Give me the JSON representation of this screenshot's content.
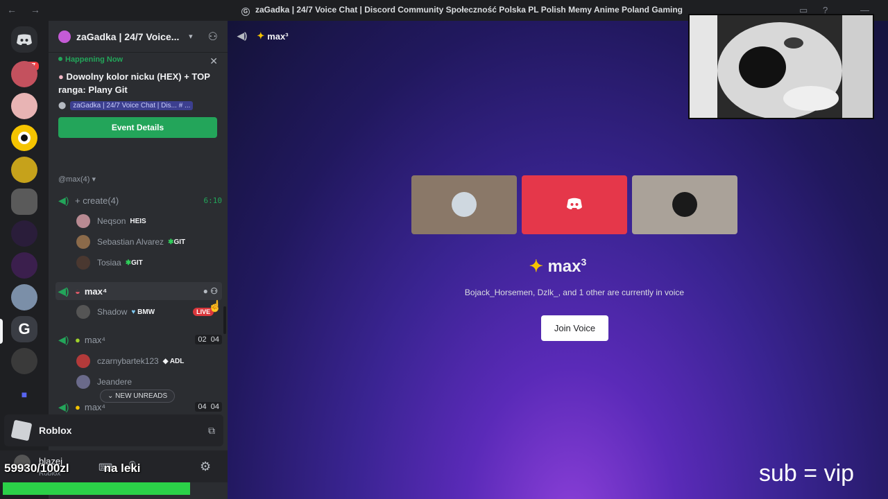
{
  "window": {
    "title": "zaGadka | 24/7 Voice Chat | Discord Community Społeczność Polska PL Polish Memy Anime Poland Gaming",
    "nav": "← →"
  },
  "rail": {
    "badge": "17"
  },
  "server": {
    "name": "zaGadka | 24/7 Voice..."
  },
  "event": {
    "status": "Happening Now",
    "title": "Dowolny kolor nicku (HEX) + TOP ranga: Plany Git",
    "location": "zaGadka | 24/7 Voice Chat | Dis...",
    "location_suffix": "# ...",
    "button": "Event Details"
  },
  "channels": {
    "category": "@max(4)",
    "items": [
      {
        "name": "+ create(4)",
        "right": "6:10"
      },
      {
        "name": "max⁴"
      },
      {
        "name": "max⁴",
        "right_a": "02",
        "right_b": "04"
      },
      {
        "name": "max⁴",
        "right_a": "04",
        "right_b": "04"
      }
    ],
    "users": [
      {
        "name": "Neqson",
        "tag": "HEIS"
      },
      {
        "name": "Sebastian Alvarez",
        "tag": "GIT"
      },
      {
        "name": "Tosiaa",
        "tag": "GIT"
      },
      {
        "name": "Shadow",
        "tag": "BMW",
        "live": "LIVE"
      },
      {
        "name": "czarnybartek123",
        "tag": "ADL"
      },
      {
        "name": "Jeandere"
      }
    ],
    "new_unreads": "NEW UNREADS"
  },
  "game": {
    "name": "Roblox",
    "panel_user": "blazej",
    "panel_status": "Roblox"
  },
  "voice": {
    "header": "max³",
    "name": "max",
    "sup": "3",
    "subtitle": "Bojack_Horsemen, Dzlk_, and 1 other are currently in voice",
    "join": "Join Voice"
  },
  "overlay": {
    "counter": "59930/100zl",
    "muted_label": "na leki",
    "bottom_right": "sub = vip",
    "progress_fraction": 0.6
  }
}
